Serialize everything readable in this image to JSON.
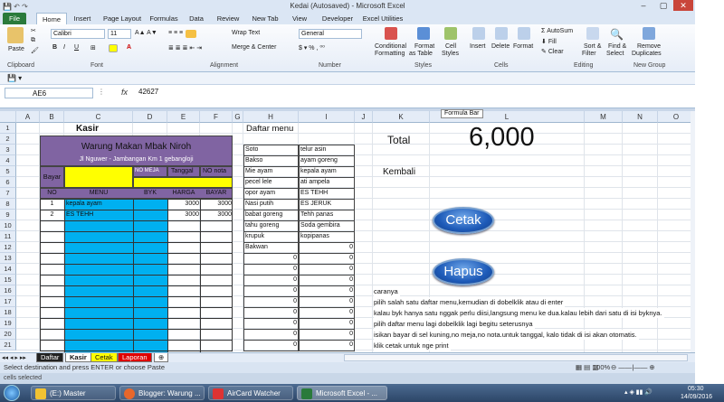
{
  "window": {
    "title": "Kedai (Autosaved) - Microsoft Excel"
  },
  "ribbon": {
    "tabs": [
      "File",
      "Home",
      "Insert",
      "Page Layout",
      "Formulas",
      "Data",
      "Review",
      "New Tab",
      "View",
      "Developer",
      "Excel Utilities"
    ],
    "paste": "Paste",
    "font_name": "Calibri",
    "font_size": "11",
    "wrap_text": "Wrap Text",
    "merge_center": "Merge & Center",
    "number_format": "General",
    "conditional": "Conditional",
    "formatting": "Formatting",
    "format_as": "Format",
    "as_table": "as Table",
    "cell": "Cell",
    "styles_btn": "Styles",
    "insert": "Insert",
    "delete": "Delete",
    "format": "Format",
    "autosum": "AutoSum",
    "fill": "Fill",
    "clear": "Clear",
    "sort": "Sort &",
    "filter": "Filter",
    "find": "Find &",
    "select": "Select",
    "remove": "Remove",
    "duplicates": "Duplicates",
    "groups": [
      "Clipboard",
      "Font",
      "Alignment",
      "Number",
      "Styles",
      "Cells",
      "Editing",
      "New Group"
    ]
  },
  "formula_bar": {
    "name_box": "AE6",
    "fx": "fx",
    "value": "42627",
    "tooltip": "Formula Bar"
  },
  "columns": [
    "A",
    "B",
    "C",
    "D",
    "E",
    "F",
    "G",
    "H",
    "I",
    "J",
    "K",
    "L",
    "M",
    "N",
    "O"
  ],
  "rows": [
    "1",
    "2",
    "3",
    "4",
    "5",
    "6",
    "7",
    "8",
    "9",
    "10",
    "11",
    "12",
    "13",
    "14",
    "15",
    "16",
    "17",
    "18",
    "19",
    "20",
    "21"
  ],
  "kasir": {
    "title": "Kasir",
    "shop": "Warung Makan Mbak Niroh",
    "address": "Jl Nguwer - Jambangan Km 1 gebangloji",
    "bayar": "Bayar",
    "no_meja": "NO MEJA",
    "tanggal": "Tanggal",
    "no_nota": "NO nota",
    "headers": [
      "NO",
      "MENU",
      "BYK",
      "HARGA",
      "BAYAR"
    ],
    "items": [
      {
        "no": "1",
        "menu": "kepala ayam",
        "harga": "3000",
        "bayar": "3000"
      },
      {
        "no": "2",
        "menu": "ES TEHH",
        "harga": "3000",
        "bayar": "3000"
      }
    ]
  },
  "menu": {
    "title": "Daftar menu",
    "rows": [
      [
        "Soto",
        "telur asin"
      ],
      [
        "Bakso",
        "ayam goreng"
      ],
      [
        "Mie ayam",
        "kepala ayam"
      ],
      [
        "pecel lele",
        "ati ampela"
      ],
      [
        "opor ayam",
        "ES TEHH"
      ],
      [
        "Nasi putih",
        "ES JERUK"
      ],
      [
        "babat goreng",
        "Tehh panas"
      ],
      [
        "tahu goreng",
        "Soda gembira"
      ],
      [
        "krupuk",
        "kopipanas"
      ],
      [
        "Bakwan",
        "0"
      ]
    ],
    "zero": "0"
  },
  "summary": {
    "total_label": "Total",
    "total_value": "6,000",
    "kembali_label": "Kembali"
  },
  "buttons": {
    "cetak": "Cetak",
    "hapus": "Hapus"
  },
  "notes": [
    "caranya",
    "pilih salah satu  daftar menu,kemudian di dobelklik atau di enter",
    "kalau byk hanya satu nggak perlu diisi,langsung menu ke dua.kalau lebih dari satu di isi byknya.",
    "pilih daftar menu lagi dobelklik lagi begitu seterusnya",
    "isikan bayar di sel kuning,no meja,no nota.untuk tanggal, kalo tidak di isi akan otomatis.",
    "klik cetak untuk nge print"
  ],
  "sheets": [
    "Daftar",
    "Kasir",
    "Cetak",
    "Laporan"
  ],
  "status": {
    "text": "Select destination and press ENTER or choose Paste",
    "zoom": "100%",
    "below": "cells selected"
  },
  "taskbar": {
    "items": [
      "(E:) Master",
      "Blogger: Warung ...",
      "AirCard Watcher",
      "Microsoft Excel - ..."
    ],
    "time": "05:30",
    "date": "14/09/2016"
  },
  "colors": {
    "purple": "#8064a2",
    "yellow": "#ffff00",
    "cyan": "#00b0f0",
    "excel_green": "#2a7a3b"
  }
}
